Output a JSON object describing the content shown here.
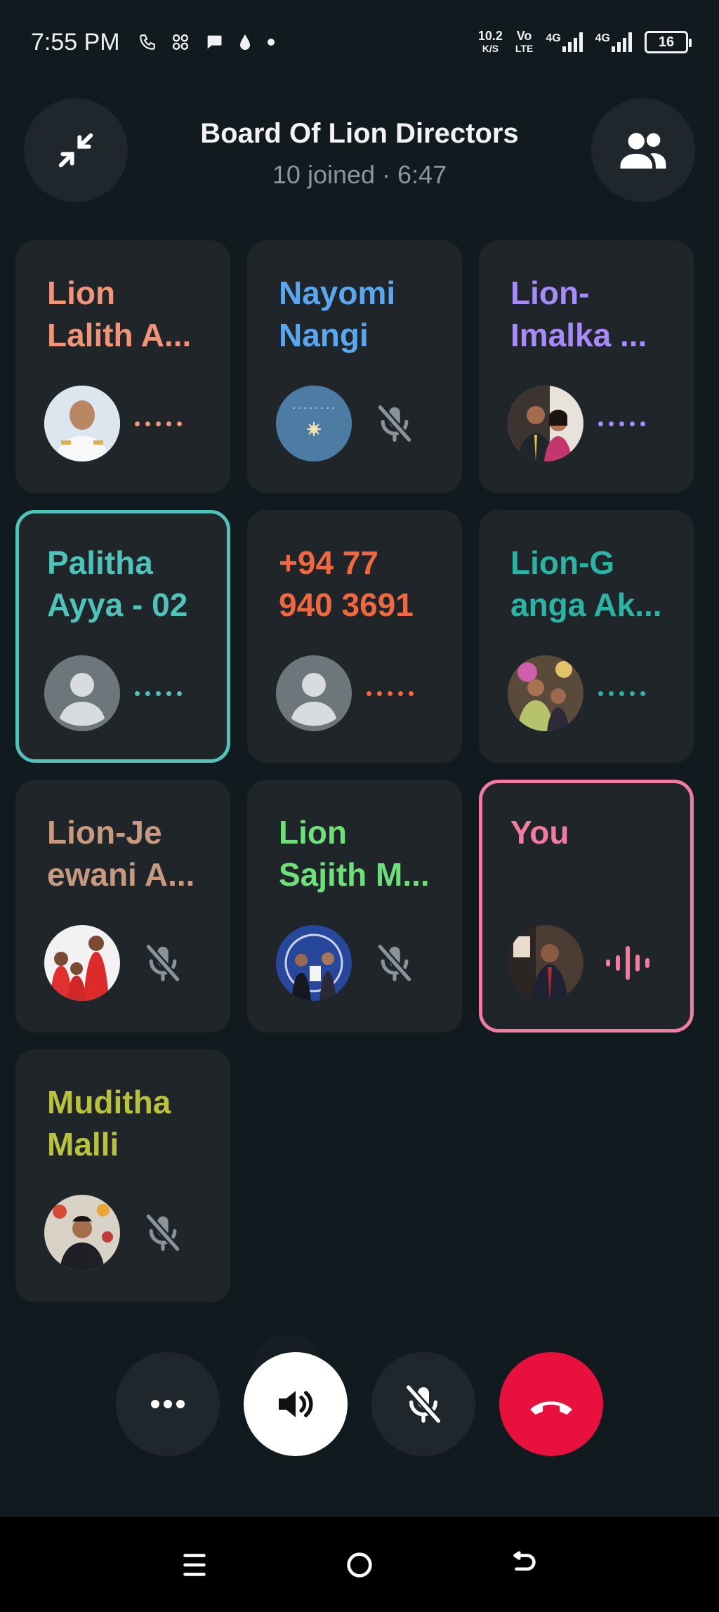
{
  "status_bar": {
    "time": "7:55 PM",
    "net_speed_value": "10.2",
    "net_speed_unit": "K/S",
    "volte_top": "Vo",
    "volte_bottom": "LTE",
    "net1": "4G",
    "net2": "4G",
    "battery": "16"
  },
  "header": {
    "title": "Board Of Lion Directors",
    "subtitle": "10 joined · 6:47"
  },
  "participants": [
    {
      "name": "Lion\nLalith A...",
      "color": "#f0957a",
      "status": "connecting",
      "avatar": "photo-officer"
    },
    {
      "name": "Nayomi\nNangi",
      "color": "#5aa7ef",
      "status": "muted",
      "avatar": "photo-flower"
    },
    {
      "name": "Lion-\nImalka ...",
      "color": "#a78bfa",
      "status": "connecting",
      "avatar": "photo-couple"
    },
    {
      "name": "Palitha\nAyya - 02",
      "color": "#4fc3b9",
      "status": "connecting",
      "avatar": "placeholder"
    },
    {
      "name": "+94 77\n940 3691",
      "color": "#f0683f",
      "status": "connecting",
      "avatar": "placeholder"
    },
    {
      "name": "Lion-G\nanga Ak...",
      "color": "#2bb3a4",
      "status": "connecting",
      "avatar": "photo-couple-2"
    },
    {
      "name": "Lion-Je\newani A...",
      "color": "#c79a7f",
      "status": "muted",
      "avatar": "photo-family"
    },
    {
      "name": "Lion\nSajith M...",
      "color": "#6ee07a",
      "status": "muted",
      "avatar": "photo-award"
    },
    {
      "name": "You",
      "color": "#f27ba0",
      "status": "speaking",
      "avatar": "photo-you"
    },
    {
      "name": "Muditha\nMalli",
      "color": "#b8c23a",
      "status": "muted",
      "avatar": "photo-man"
    }
  ],
  "controls": {
    "more": "more-icon",
    "speaker": "speaker-icon",
    "mic": "mic-off-icon",
    "end": "end-call-icon"
  },
  "nav": [
    "menu-icon",
    "home-icon",
    "back-icon"
  ]
}
